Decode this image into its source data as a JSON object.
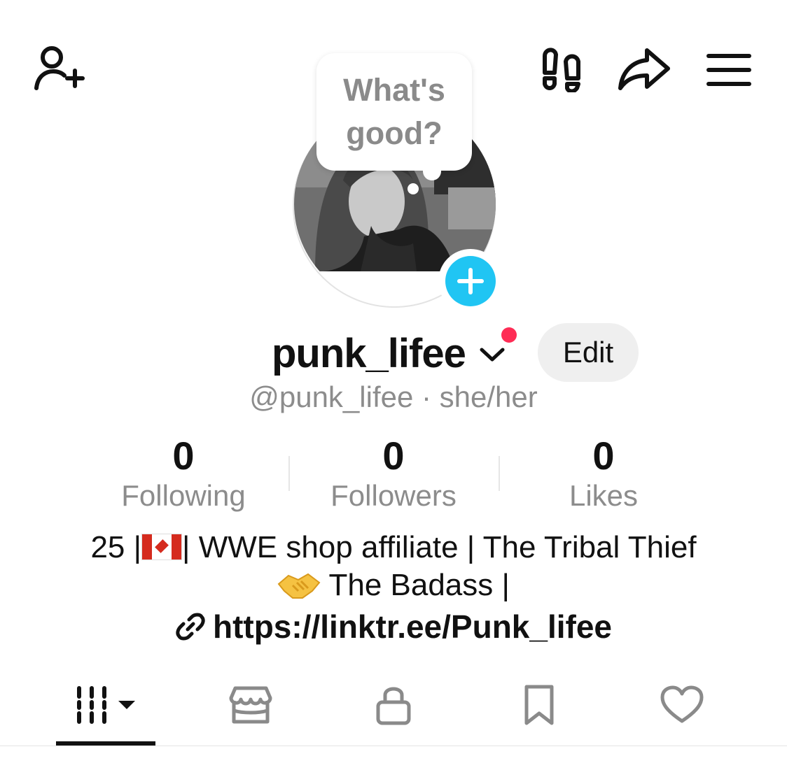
{
  "header": {
    "left_icon": "add-friend-icon",
    "right_icons": [
      "footprints-icon",
      "share-icon",
      "menu-icon"
    ]
  },
  "avatar": {
    "story_bubble_text": "What's good?",
    "add_story_icon": "plus-icon"
  },
  "profile": {
    "username": "punk_lifee",
    "edit_label": "Edit",
    "handle": "@punk_lifee",
    "separator": " · ",
    "pronouns": "she/her",
    "notification_color": "#fe2c55"
  },
  "stats": [
    {
      "value": "0",
      "label": "Following"
    },
    {
      "value": "0",
      "label": "Followers"
    },
    {
      "value": "0",
      "label": "Likes"
    }
  ],
  "bio": {
    "part1": "25 |",
    "flag": "canada-flag-emoji",
    "part2": "| WWE shop affiliate | The Tribal Thief",
    "emoji": "handshake-emoji",
    "part3": " The Badass |",
    "link_icon": "link-icon",
    "link": "https://linktr.ee/Punk_lifee"
  },
  "tabs": [
    {
      "name": "videos",
      "icon": "grid-icon",
      "selected": true
    },
    {
      "name": "shop",
      "icon": "store-icon",
      "selected": false
    },
    {
      "name": "private",
      "icon": "lock-icon",
      "selected": false
    },
    {
      "name": "saved",
      "icon": "bookmark-icon",
      "selected": false
    },
    {
      "name": "liked",
      "icon": "heart-icon",
      "selected": false
    }
  ],
  "colors": {
    "accent_blue": "#20c5f3",
    "edit_button_bg": "#efefef",
    "secondary_text": "#8c8c8c"
  }
}
